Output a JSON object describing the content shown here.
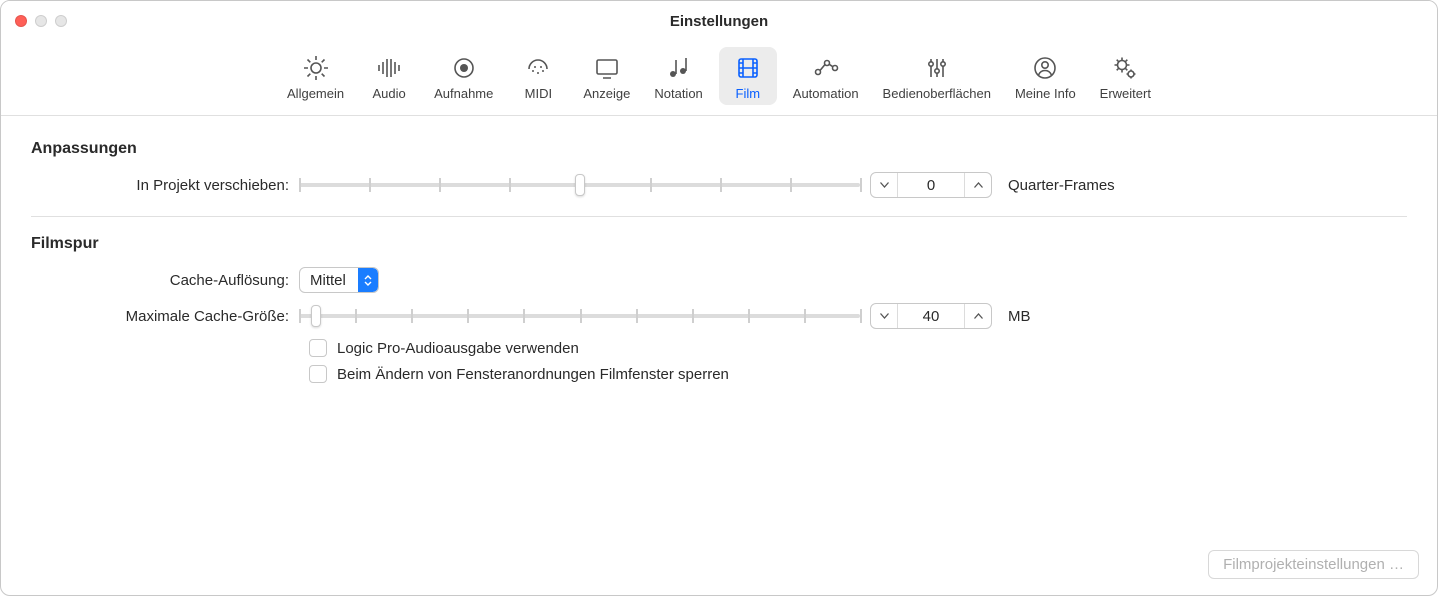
{
  "window": {
    "title": "Einstellungen"
  },
  "tabs": [
    {
      "id": "allgemein",
      "label": "Allgemein"
    },
    {
      "id": "audio",
      "label": "Audio"
    },
    {
      "id": "aufnahme",
      "label": "Aufnahme"
    },
    {
      "id": "midi",
      "label": "MIDI"
    },
    {
      "id": "anzeige",
      "label": "Anzeige"
    },
    {
      "id": "notation",
      "label": "Notation"
    },
    {
      "id": "film",
      "label": "Film",
      "active": true
    },
    {
      "id": "automation",
      "label": "Automation"
    },
    {
      "id": "bedienoberflaechen",
      "label": "Bedienoberflächen"
    },
    {
      "id": "meine-info",
      "label": "Meine Info"
    },
    {
      "id": "erweitert",
      "label": "Erweitert"
    }
  ],
  "sections": {
    "anpassungen": {
      "heading": "Anpassungen",
      "move_label": "In Projekt verschieben:",
      "move_value": "0",
      "move_unit": "Quarter-Frames"
    },
    "filmspur": {
      "heading": "Filmspur",
      "cache_res_label": "Cache-Auflösung:",
      "cache_res_value": "Mittel",
      "max_cache_label": "Maximale Cache-Größe:",
      "max_cache_value": "40",
      "max_cache_unit": "MB",
      "cb1_label": "Logic Pro-Audioausgabe verwenden",
      "cb2_label": "Beim Ändern von Fensteranordnungen Filmfenster sperren"
    }
  },
  "footer": {
    "button": "Filmprojekteinstellungen …"
  }
}
